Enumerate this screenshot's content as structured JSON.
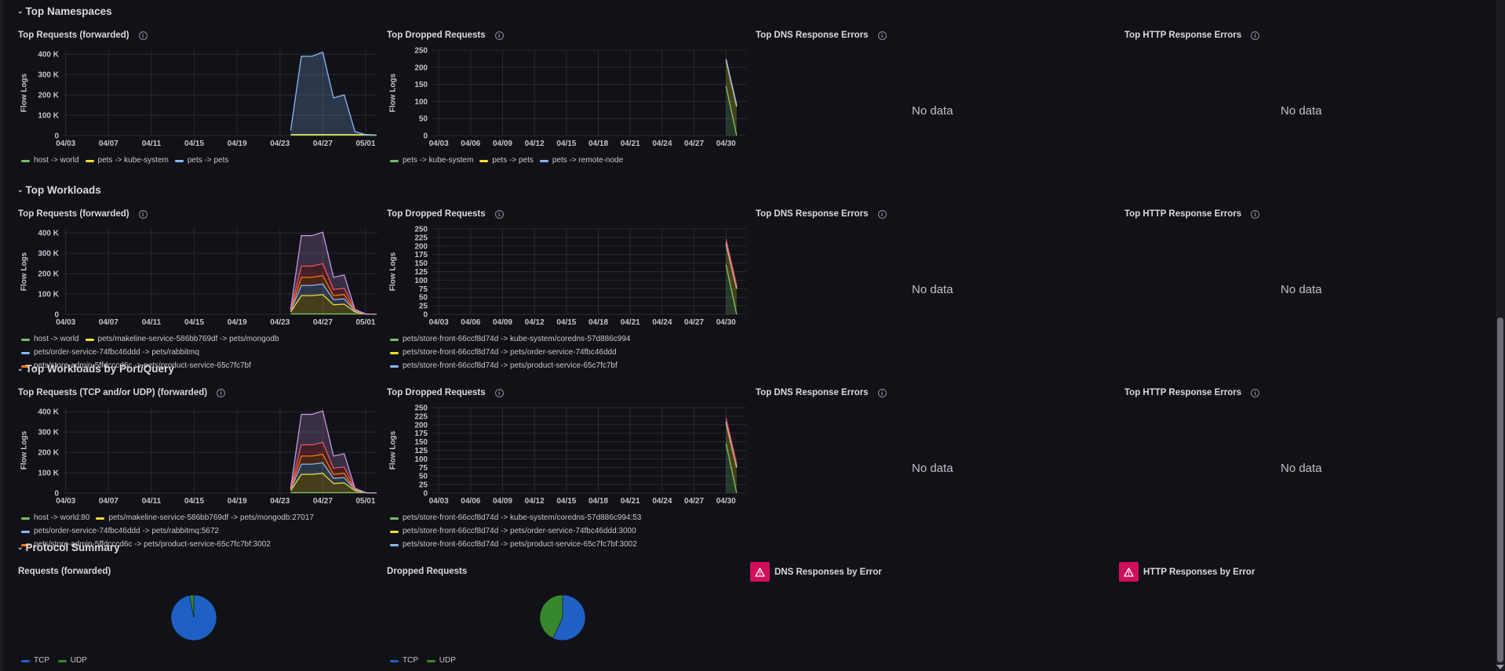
{
  "colors": {
    "green": "#73bf69",
    "yellow": "#fade2a",
    "blue": "#8ab8ff",
    "orange": "#ff780a",
    "purple": "#ca95e5",
    "red": "#f2495c",
    "pie_blue": "#1f60c4",
    "pie_green": "#37872d"
  },
  "rows": [
    {
      "title": "Top Namespaces"
    },
    {
      "title": "Top Workloads"
    },
    {
      "title": "Top Workloads by Port/Query"
    },
    {
      "title": "Protocol Summary"
    }
  ],
  "common": {
    "ylabel": "Flow Logs",
    "no_data": "No data",
    "dns_title": "Top DNS Response Errors",
    "http_title": "Top HTTP Response Errors",
    "dropped_title": "Top Dropped Requests",
    "requests_title": "Top Requests (forwarded)",
    "requests_tcp_title": "Top Requests (TCP and/or UDP) (forwarded)"
  },
  "summary": {
    "requests_title": "Requests (forwarded)",
    "dropped_title": "Dropped Requests",
    "dns_title": "DNS Responses by Error",
    "http_title": "HTTP Responses by Error",
    "legend_requests": [
      "TCP",
      "UDP"
    ],
    "legend_dropped": [
      "TCP",
      "UDP"
    ]
  },
  "chart_data": [
    {
      "id": "ns-requests",
      "type": "area",
      "title": "Top Requests (forwarded)",
      "ylabel": "Flow Logs",
      "ylim": [
        0,
        420000
      ],
      "yticks": [
        "0",
        "100 K",
        "200 K",
        "300 K",
        "400 K"
      ],
      "xticks": [
        "04/03",
        "04/07",
        "04/11",
        "04/15",
        "04/19",
        "04/23",
        "04/27",
        "05/01"
      ],
      "x": [
        "04/24",
        "04/25",
        "04/26",
        "04/27",
        "04/28",
        "04/29",
        "04/30",
        "05/01",
        "05/02"
      ],
      "series": [
        {
          "name": "host -> world",
          "color": "green",
          "values": [
            2000,
            2000,
            2000,
            2000,
            2000,
            2000,
            2000,
            2000,
            1000
          ]
        },
        {
          "name": "pets -> kube-system",
          "color": "yellow",
          "values": [
            3000,
            3000,
            3000,
            3000,
            3000,
            3000,
            3000,
            3000,
            2000
          ]
        },
        {
          "name": "pets -> pets",
          "color": "blue",
          "values": [
            20000,
            385000,
            385000,
            405000,
            180000,
            195000,
            15000,
            0,
            0
          ]
        }
      ]
    },
    {
      "id": "ns-dropped",
      "type": "area",
      "title": "Top Dropped Requests",
      "ylabel": "Flow Logs",
      "ylim": [
        0,
        250
      ],
      "yticks": [
        "0",
        "50",
        "100",
        "150",
        "200",
        "250"
      ],
      "xticks": [
        "04/03",
        "04/06",
        "04/09",
        "04/12",
        "04/15",
        "04/18",
        "04/21",
        "04/24",
        "04/27",
        "04/30"
      ],
      "x": [
        "04/30",
        "05/01"
      ],
      "series": [
        {
          "name": "pets -> kube-system",
          "color": "green",
          "values": [
            145,
            0
          ]
        },
        {
          "name": "pets -> pets",
          "color": "yellow",
          "values": [
            75,
            85
          ]
        },
        {
          "name": "pets -> remote-node",
          "color": "blue",
          "values": [
            5,
            5
          ]
        }
      ]
    },
    {
      "id": "wl-requests",
      "type": "area",
      "title": "Top Requests (forwarded)",
      "ylabel": "Flow Logs",
      "ylim": [
        0,
        420000
      ],
      "yticks": [
        "0",
        "100 K",
        "200 K",
        "300 K",
        "400 K"
      ],
      "xticks": [
        "04/03",
        "04/07",
        "04/11",
        "04/15",
        "04/19",
        "04/23",
        "04/27",
        "05/01"
      ],
      "x": [
        "04/24",
        "04/25",
        "04/26",
        "04/27",
        "04/28",
        "04/29",
        "04/30",
        "05/01",
        "05/02"
      ],
      "series": [
        {
          "name": "host -> world",
          "color": "green",
          "values": [
            2000,
            2000,
            2000,
            2000,
            2000,
            2000,
            2000,
            2000,
            1000
          ]
        },
        {
          "name": "pets/makeline-service-586bb769df -> pets/mongodb",
          "color": "yellow",
          "values": [
            10000,
            90000,
            90000,
            95000,
            45000,
            48000,
            10000,
            0,
            0
          ]
        },
        {
          "name": "pets/order-service-74fbc46ddd -> pets/rabbitmq",
          "color": "blue",
          "values": [
            5000,
            50000,
            50000,
            52000,
            25000,
            26000,
            5000,
            0,
            0
          ]
        },
        {
          "name": "pets/store-admin-5ffdcccd6c -> pets/product-service-65c7fc7bf",
          "color": "orange",
          "values": [
            3000,
            40000,
            40000,
            42000,
            20000,
            21000,
            3000,
            0,
            0
          ]
        },
        {
          "name": "",
          "color": "red",
          "values": [
            2000,
            55000,
            55000,
            58000,
            30000,
            31000,
            2000,
            0,
            0
          ]
        },
        {
          "name": "",
          "color": "purple",
          "values": [
            2000,
            150000,
            150000,
            155000,
            60000,
            65000,
            2000,
            0,
            0
          ]
        }
      ]
    },
    {
      "id": "wl-dropped",
      "type": "area",
      "title": "Top Dropped Requests",
      "ylabel": "Flow Logs",
      "ylim": [
        0,
        250
      ],
      "yticks": [
        "0",
        "25",
        "50",
        "75",
        "100",
        "125",
        "150",
        "175",
        "200",
        "225",
        "250"
      ],
      "xticks": [
        "04/03",
        "04/06",
        "04/09",
        "04/12",
        "04/15",
        "04/18",
        "04/21",
        "04/24",
        "04/27",
        "04/30"
      ],
      "x": [
        "04/30",
        "05/01"
      ],
      "series": [
        {
          "name": "pets/store-front-66ccf8d74d -> kube-system/coredns-57d886c994",
          "color": "green",
          "values": [
            145,
            0
          ]
        },
        {
          "name": "pets/store-front-66ccf8d74d -> pets/order-service-74fbc46ddd",
          "color": "yellow",
          "values": [
            60,
            75
          ]
        },
        {
          "name": "pets/store-front-66ccf8d74d -> pets/product-service-65c7fc7bf",
          "color": "blue",
          "values": [
            5,
            5
          ]
        },
        {
          "name": "",
          "color": "red",
          "values": [
            10,
            5
          ]
        }
      ]
    },
    {
      "id": "pq-requests",
      "type": "area",
      "title": "Top Requests (TCP and/or UDP) (forwarded)",
      "ylabel": "Flow Logs",
      "ylim": [
        0,
        420000
      ],
      "yticks": [
        "0",
        "100 K",
        "200 K",
        "300 K",
        "400 K"
      ],
      "xticks": [
        "04/03",
        "04/07",
        "04/11",
        "04/15",
        "04/19",
        "04/23",
        "04/27",
        "05/01"
      ],
      "x": [
        "04/24",
        "04/25",
        "04/26",
        "04/27",
        "04/28",
        "04/29",
        "04/30",
        "05/01",
        "05/02"
      ],
      "series": [
        {
          "name": "host -> world:80",
          "color": "green",
          "values": [
            2000,
            2000,
            2000,
            2000,
            2000,
            2000,
            2000,
            2000,
            1000
          ]
        },
        {
          "name": "pets/makeline-service-586bb769df -> pets/mongodb:27017",
          "color": "yellow",
          "values": [
            10000,
            90000,
            90000,
            95000,
            45000,
            48000,
            10000,
            0,
            0
          ]
        },
        {
          "name": "pets/order-service-74fbc46ddd -> pets/rabbitmq:5672",
          "color": "blue",
          "values": [
            5000,
            50000,
            50000,
            52000,
            25000,
            26000,
            5000,
            0,
            0
          ]
        },
        {
          "name": "pets/store-admin-5ffdcccd6c -> pets/product-service-65c7fc7bf:3002",
          "color": "orange",
          "values": [
            3000,
            40000,
            40000,
            42000,
            20000,
            21000,
            3000,
            0,
            0
          ]
        },
        {
          "name": "",
          "color": "red",
          "values": [
            2000,
            55000,
            55000,
            58000,
            30000,
            31000,
            2000,
            0,
            0
          ]
        },
        {
          "name": "",
          "color": "purple",
          "values": [
            2000,
            150000,
            150000,
            155000,
            60000,
            65000,
            2000,
            0,
            0
          ]
        }
      ]
    },
    {
      "id": "pq-dropped",
      "type": "area",
      "title": "Top Dropped Requests",
      "ylabel": "Flow Logs",
      "ylim": [
        0,
        250
      ],
      "yticks": [
        "0",
        "25",
        "50",
        "75",
        "100",
        "125",
        "150",
        "175",
        "200",
        "225",
        "250"
      ],
      "xticks": [
        "04/03",
        "04/06",
        "04/09",
        "04/12",
        "04/15",
        "04/18",
        "04/21",
        "04/24",
        "04/27",
        "04/30"
      ],
      "x": [
        "04/30",
        "05/01"
      ],
      "series": [
        {
          "name": "pets/store-front-66ccf8d74d -> kube-system/coredns-57d886c994:53",
          "color": "green",
          "values": [
            145,
            0
          ]
        },
        {
          "name": "pets/store-front-66ccf8d74d -> pets/order-service-74fbc46ddd:3000",
          "color": "yellow",
          "values": [
            60,
            75
          ]
        },
        {
          "name": "pets/store-front-66ccf8d74d -> pets/product-service-65c7fc7bf:3002",
          "color": "blue",
          "values": [
            5,
            5
          ]
        },
        {
          "name": "",
          "color": "red",
          "values": [
            10,
            5
          ]
        }
      ]
    },
    {
      "id": "pie-requests",
      "type": "pie",
      "title": "Requests (forwarded)",
      "slices": [
        {
          "name": "TCP",
          "color": "pie_blue",
          "value": 97
        },
        {
          "name": "UDP",
          "color": "pie_green",
          "value": 3
        }
      ]
    },
    {
      "id": "pie-dropped",
      "type": "pie",
      "title": "Dropped Requests",
      "slices": [
        {
          "name": "TCP",
          "color": "pie_blue",
          "value": 57
        },
        {
          "name": "UDP",
          "color": "pie_green",
          "value": 43
        }
      ]
    }
  ]
}
